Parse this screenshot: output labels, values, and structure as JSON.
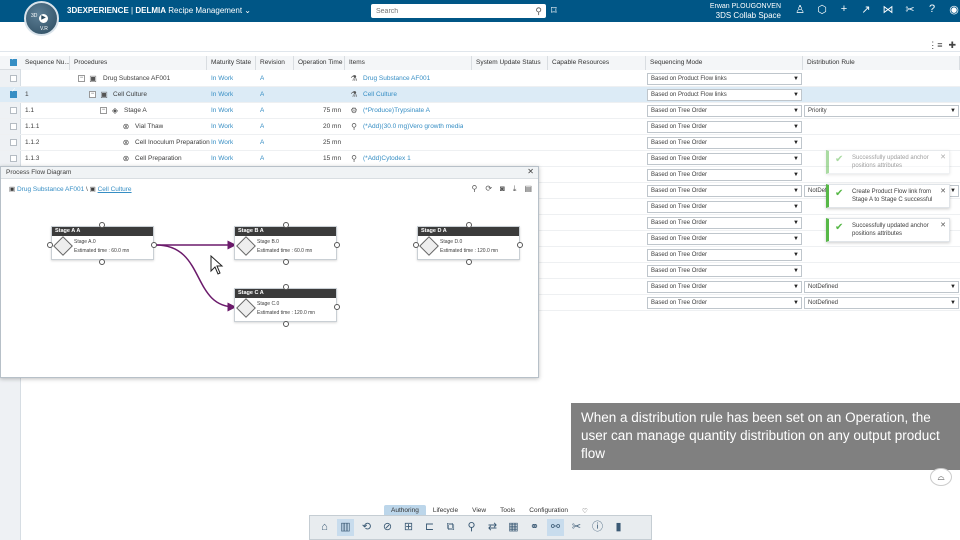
{
  "app": {
    "brand_prefix": "3DEXPERIENCE",
    "brand_separator": " | ",
    "brand_main": "DELMIA",
    "app_name": "Recipe Management",
    "compass_3d": "3D",
    "compass_version": "V.R",
    "search_placeholder": "Search",
    "user_name": "Erwan PLOUGONVEN",
    "space_name": "3DS Collab Space"
  },
  "grid": {
    "headers": [
      "Sequence Nu...",
      "Procedures",
      "Maturity State",
      "Revision",
      "Operation Time",
      "Items",
      "System Update Status",
      "Capable Resources",
      "Sequencing Mode",
      "Distribution Rule"
    ],
    "rows": [
      {
        "seq": "",
        "proc": "Drug Substance AF001",
        "state": "In Work",
        "rev": "A",
        "time": "",
        "item": "Drug Substance AF001",
        "mode": "Based on Product Flow links",
        "dist": "",
        "selected": false
      },
      {
        "seq": "1",
        "proc": "Cell Culture",
        "state": "In Work",
        "rev": "A",
        "time": "",
        "item": "Cell Culture",
        "mode": "Based on Product Flow links",
        "dist": "",
        "selected": true
      },
      {
        "seq": "1.1",
        "proc": "Stage A",
        "state": "In Work",
        "rev": "A",
        "time": "75 mn",
        "item": "(*Produce)Trypsinate A",
        "mode": "Based on Tree Order",
        "dist": "Priority",
        "selected": false
      },
      {
        "seq": "1.1.1",
        "proc": "Vial Thaw",
        "state": "In Work",
        "rev": "A",
        "time": "20 mn",
        "item": "(*Add)(30.0 mg)Vero growth media",
        "mode": "Based on Tree Order",
        "dist": "",
        "selected": false
      },
      {
        "seq": "1.1.2",
        "proc": "Cell Inoculum Preparation",
        "state": "In Work",
        "rev": "A",
        "time": "25 mn",
        "item": "",
        "mode": "Based on Tree Order",
        "dist": "",
        "selected": false
      },
      {
        "seq": "1.1.3",
        "proc": "Cell Preparation",
        "state": "In Work",
        "rev": "A",
        "time": "15 mn",
        "item": "(*Add)Cytodex 1",
        "mode": "Based on Tree Order",
        "dist": "",
        "selected": false
      }
    ],
    "extra_modes": [
      "Based on Tree Order",
      "Based on Tree Order",
      "Based on Tree Order",
      "Based on Tree Order",
      "Based on Tree Order",
      "Based on Tree Order",
      "Based on Tree Order",
      "Based on Tree Order",
      "Based on Tree Order",
      "Based on Tree Order"
    ],
    "extra_dists": [
      "",
      "NotDefin",
      "",
      "",
      "",
      "",
      "",
      "",
      "NotDefined",
      "NotDefined"
    ]
  },
  "pfd": {
    "title": "Process Flow Diagram",
    "crumb_root": "Drug Substance AF001",
    "crumb_sep": "\\",
    "crumb_current": "Cell Culture",
    "nodes": [
      {
        "header": "Stage A  A",
        "name": "Stage A.0",
        "time": "Estimated time : 60.0 mn"
      },
      {
        "header": "Stage B  A",
        "name": "Stage B.0",
        "time": "Estimated time : 60.0 mn"
      },
      {
        "header": "Stage C  A",
        "name": "Stage C.0",
        "time": "Estimated time : 120.0 mn"
      },
      {
        "header": "Stage D  A",
        "name": "Stage D.0",
        "time": "Estimated time : 120.0 mn"
      }
    ]
  },
  "toasts": [
    {
      "text": "Successfully updated anchor positions attributes"
    },
    {
      "text": "Create Product Flow link from Stage A to Stage C successful"
    },
    {
      "text": "Successfully updated anchor positions attributes"
    }
  ],
  "caption": "When a distribution rule has been set on an Operation, the user can manage quantity distribution on any output product flow",
  "bottom_tabs": [
    "Authoring",
    "Lifecycle",
    "View",
    "Tools",
    "Configuration"
  ],
  "colors": {
    "topbar": "#005686",
    "link": "#368ec4",
    "flow_link": "#6b1a6b",
    "success": "#57b847"
  }
}
